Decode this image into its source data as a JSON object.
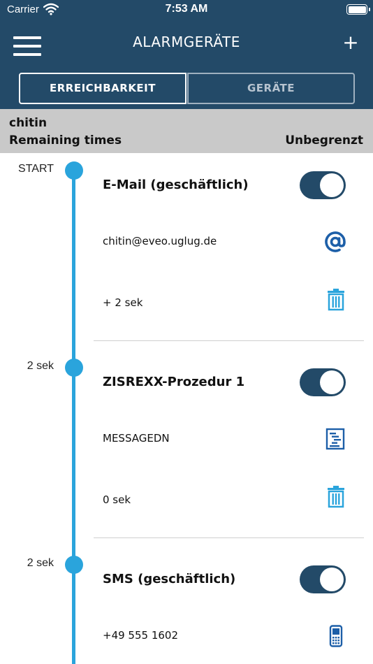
{
  "status_bar": {
    "carrier": "Carrier",
    "time": "7:53 AM",
    "wifi_icon": "wifi-icon",
    "battery_icon": "battery-icon"
  },
  "header": {
    "title": "ALARMGERÄTE",
    "menu_icon": "hamburger-menu-icon",
    "add_label": "+",
    "tabs": [
      {
        "label": "ERREICHBARKEIT",
        "active": true
      },
      {
        "label": "GERÄTE",
        "active": false
      }
    ]
  },
  "info": {
    "name": "chitin",
    "remaining_label": "Remaining times",
    "remaining_value": "Unbegrenzt"
  },
  "entries": [
    {
      "time_label": "START",
      "title": "E-Mail (geschäftlich)",
      "enabled": true,
      "detail": "chitin@eveo.uglug.de",
      "detail_icon": "at-sign-icon",
      "delay": "+ 2 sek",
      "delete_icon": "trash-icon"
    },
    {
      "time_label": "2 sek",
      "title": "ZISREXX-Prozedur 1",
      "enabled": true,
      "detail": "MESSAGEDN",
      "detail_icon": "script-document-icon",
      "delay": "0 sek",
      "delete_icon": "trash-icon"
    },
    {
      "time_label": "2 sek",
      "title": "SMS (geschäftlich)",
      "enabled": true,
      "detail": "+49 555 1602",
      "detail_icon": "mobile-phone-icon"
    }
  ],
  "colors": {
    "header_bg": "#234a68",
    "timeline": "#2aa4dc",
    "info_band": "#c9c9c9",
    "icon_blue": "#1d5fa8"
  }
}
